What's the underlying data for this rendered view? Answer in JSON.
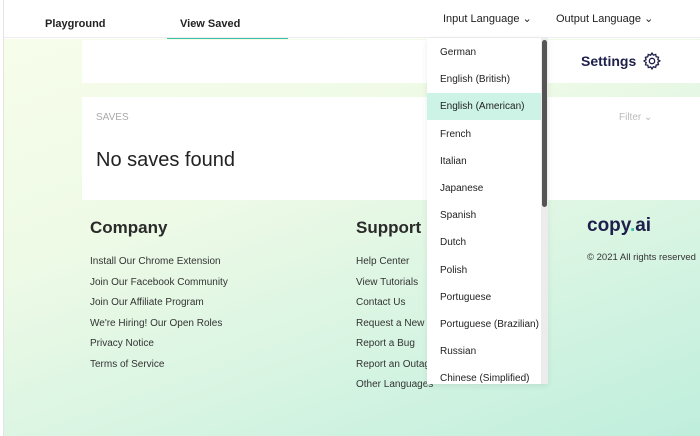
{
  "header": {
    "tabs": [
      {
        "label": "Playground"
      },
      {
        "label": "View Saved",
        "active": true
      }
    ],
    "input_language": "Input Language",
    "output_language": "Output Language"
  },
  "settings": {
    "label": "Settings",
    "icon": "gear-icon"
  },
  "saves": {
    "label": "SAVES",
    "filter": "Filter",
    "empty": "No saves found"
  },
  "footer": {
    "company": {
      "title": "Company",
      "links": [
        "Install Our Chrome Extension",
        "Join Our Facebook Community",
        "Join Our Affiliate Program",
        "We're Hiring! Our Open Roles",
        "Privacy Notice",
        "Terms of Service"
      ]
    },
    "support": {
      "title": "Support",
      "links": [
        "Help Center",
        "View Tutorials",
        "Contact Us",
        "Request a New F",
        "Report a Bug",
        "Report an Outag",
        "Other Languages"
      ]
    },
    "logo_a": "copy",
    "logo_dot": ".",
    "logo_b": "ai",
    "copyright": "© 2021 All rights reserved"
  },
  "dropdown": {
    "selected": "English (American)",
    "items": [
      "German",
      "English (British)",
      "English (American)",
      "French",
      "Italian",
      "Japanese",
      "Spanish",
      "Dutch",
      "Polish",
      "Portuguese",
      "Portuguese (Brazilian)",
      "Russian",
      "Chinese (Simplified)"
    ]
  },
  "colors": {
    "accent": "#3dbfa8",
    "navy": "#1e1f4b",
    "selected_bg": "#cdf3e6"
  }
}
